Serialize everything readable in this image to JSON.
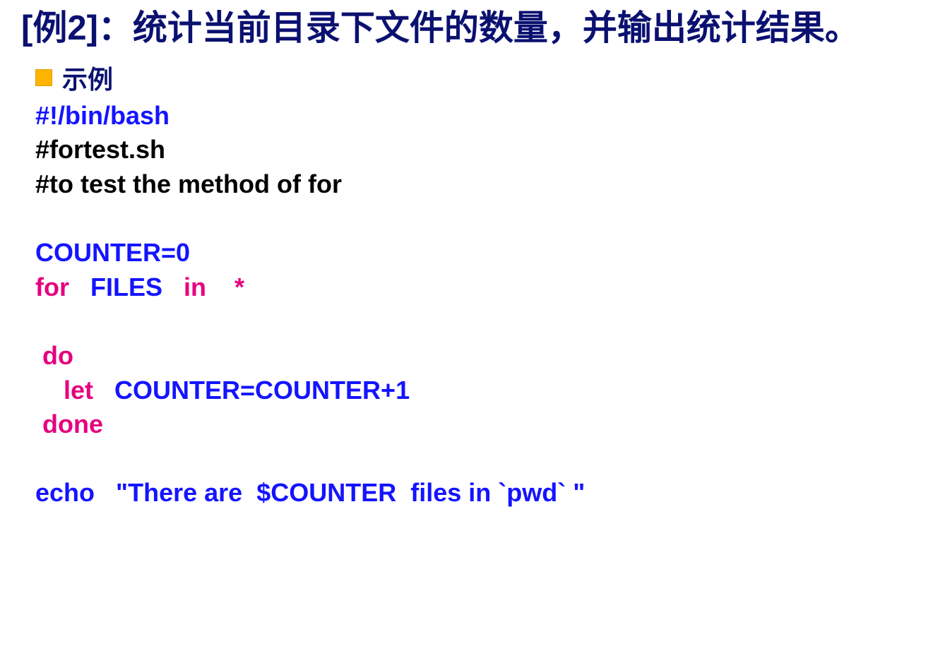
{
  "title": "[例2]：统计当前目录下文件的数量，并输出统计结果。",
  "bullet_label": "示例",
  "code": {
    "l1": "#!/bin/bash",
    "l2": "#fortest.sh",
    "l3": "#to test the method of for",
    "blank1": "",
    "l4": "COUNTER=0",
    "l5a": "for",
    "l5b": "   FILES",
    "l5c": "   in    *",
    "blank2": "",
    "l6": " do",
    "l7a": "    let",
    "l7b": "   COUNTER=COUNTER+1",
    "l8": " done",
    "blank3": "",
    "l9": "echo   \"There are  $COUNTER  files in `pwd` \""
  }
}
